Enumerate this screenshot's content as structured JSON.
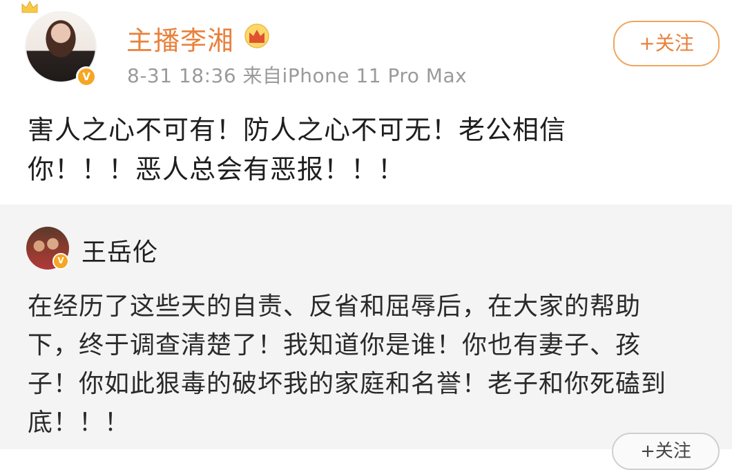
{
  "post": {
    "author_name": "主播李湘",
    "timestamp": "8-31 18:36",
    "source": "来自iPhone 11 Pro Max",
    "follow_label": "+关注",
    "content_lines": [
      "害人之心不可有！防人之心不可无！老公相信",
      "你！！！恶人总会有恶报！！！"
    ],
    "icons": [
      "crown-icon",
      "verified-badge-icon"
    ]
  },
  "repost": {
    "author_name": "王岳伦",
    "follow_label": "+关注",
    "content_lines": [
      "在经历了这些天的自责、反省和屈辱后，在大家的帮助",
      "下，终于调查清楚了！我知道你是谁！你也有妻子、孩",
      "子！你如此狠毒的破坏我的家庭和名誉！老子和你死磕到",
      "底！！！"
    ]
  },
  "badge_text": "V",
  "colors": {
    "accent_orange": "#e8813c",
    "meta_gray": "#9a9a9a",
    "repost_bg": "#f4f4f4",
    "badge": "#f5a623"
  }
}
